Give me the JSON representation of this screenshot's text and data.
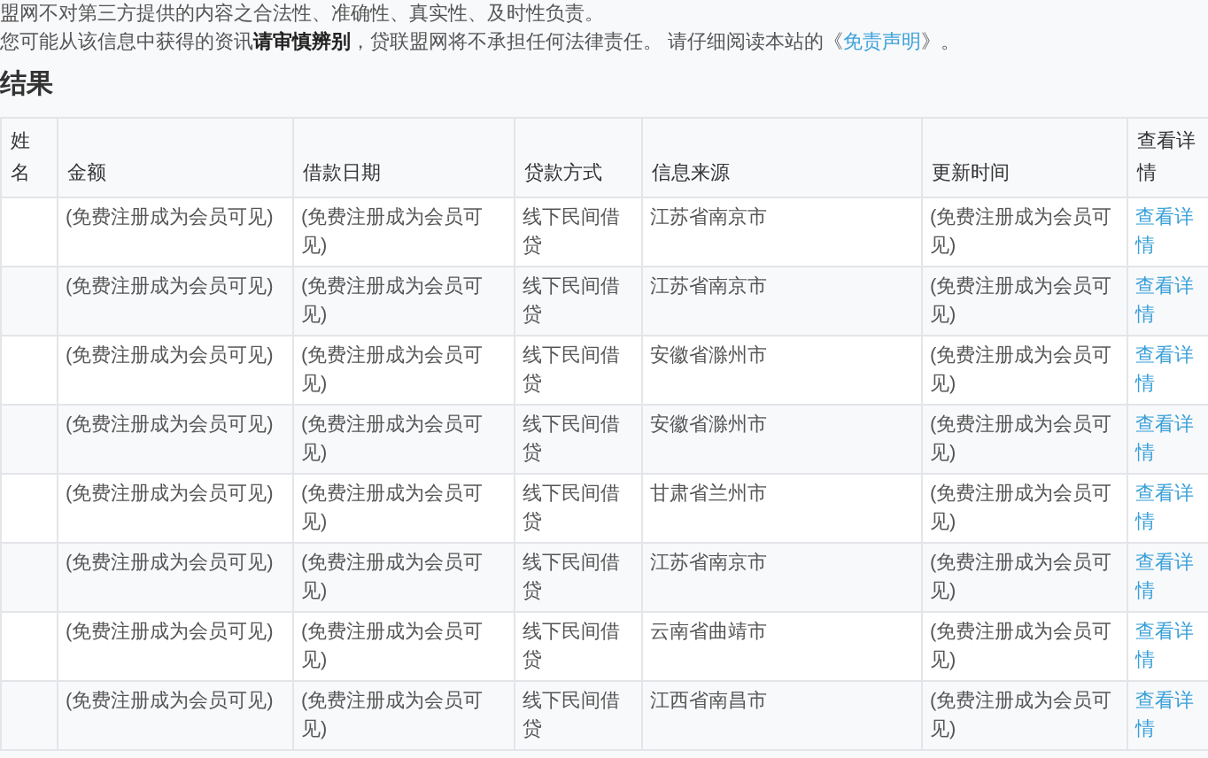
{
  "notice": {
    "line_1": "盟网不对第三方提供的内容之合法性、准确性、真实性、及时性负责。",
    "line_2_before": "您可能从该信息中获得的资讯**请审慎辨别**，贷联盟网将不承担任何法律责任。 请仔细阅读本站的《",
    "link": "免责声明",
    "line_2_after": "》。"
  },
  "heading": "结果",
  "table": {
    "columns": [
      "姓名",
      "金额",
      "借款日期",
      "贷款方式",
      "信息来源",
      "更新时间",
      "查看详情"
    ],
    "rows": [
      {
        "amount": "(免费注册成为会员可见)",
        "date": "(免费注册成为会员可见)",
        "method": "线下民间借贷",
        "source": "江苏省南京市",
        "updated": "(免费注册成为会员可见)",
        "link": "查看详情"
      },
      {
        "amount": "(免费注册成为会员可见)",
        "date": "(免费注册成为会员可见)",
        "method": "线下民间借贷",
        "source": "江苏省南京市",
        "updated": "(免费注册成为会员可见)",
        "link": "查看详情"
      },
      {
        "amount": "(免费注册成为会员可见)",
        "date": "(免费注册成为会员可见)",
        "method": "线下民间借贷",
        "source": "安徽省滁州市",
        "updated": "(免费注册成为会员可见)",
        "link": "查看详情"
      },
      {
        "amount": "(免费注册成为会员可见)",
        "date": "(免费注册成为会员可见)",
        "method": "线下民间借贷",
        "source": "安徽省滁州市",
        "updated": "(免费注册成为会员可见)",
        "link": "查看详情"
      },
      {
        "amount": "(免费注册成为会员可见)",
        "date": "(免费注册成为会员可见)",
        "method": "线下民间借贷",
        "source": "甘肃省兰州市",
        "updated": "(免费注册成为会员可见)",
        "link": "查看详情"
      },
      {
        "amount": "(免费注册成为会员可见)",
        "date": "(免费注册成为会员可见)",
        "method": "线下民间借贷",
        "source": "江苏省南京市",
        "updated": "(免费注册成为会员可见)",
        "link": "查看详情"
      },
      {
        "amount": "(免费注册成为会员可见)",
        "date": "(免费注册成为会员可见)",
        "method": "线下民间借贷",
        "source": "云南省曲靖市",
        "updated": "(免费注册成为会员可见)",
        "link": "查看详情"
      },
      {
        "amount": "(免费注册成为会员可见)",
        "date": "(免费注册成为会员可见)",
        "method": "线下民间借贷",
        "source": "江西省南昌市",
        "updated": "(免费注册成为会员可见)",
        "link": "查看详情"
      }
    ]
  }
}
